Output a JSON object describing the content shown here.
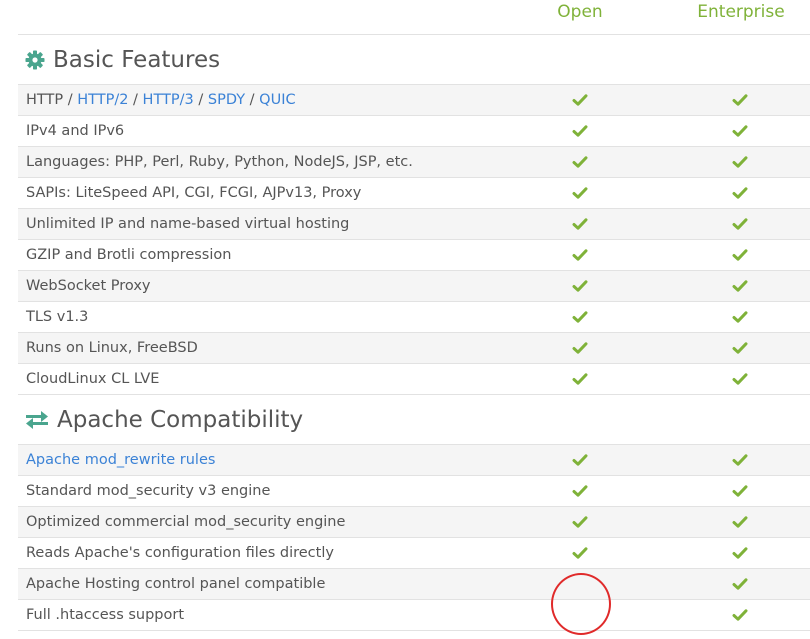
{
  "columns": {
    "open": "Open",
    "enterprise": "Enterprise"
  },
  "colors": {
    "accent": "#7fb239",
    "link": "#3b82d6",
    "icon": "#4aa58e",
    "annotation": "#e02a2a"
  },
  "basic": {
    "title": "Basic Features",
    "icon": "gear-icon",
    "http_row": {
      "p1": "HTTP",
      "sep": " / ",
      "l1": "HTTP/2",
      "l2": "HTTP/3",
      "l3": "SPDY",
      "l4": "QUIC"
    },
    "rows": [
      {
        "label": "IPv4 and IPv6",
        "open": true,
        "enterprise": true
      },
      {
        "label": "Languages: PHP, Perl, Ruby, Python, NodeJS, JSP, etc.",
        "open": true,
        "enterprise": true
      },
      {
        "label": "SAPIs: LiteSpeed API, CGI, FCGI, AJPv13, Proxy",
        "open": true,
        "enterprise": true
      },
      {
        "label": "Unlimited IP and name-based virtual hosting",
        "open": true,
        "enterprise": true
      },
      {
        "label": "GZIP and Brotli compression",
        "open": true,
        "enterprise": true
      },
      {
        "label": "WebSocket Proxy",
        "open": true,
        "enterprise": true
      },
      {
        "label": "TLS v1.3",
        "open": true,
        "enterprise": true
      },
      {
        "label": "Runs on Linux, FreeBSD",
        "open": true,
        "enterprise": true
      },
      {
        "label": "CloudLinux CL LVE",
        "open": true,
        "enterprise": true
      }
    ]
  },
  "apache": {
    "title": "Apache Compatibility",
    "icon": "exchange-arrows-icon",
    "rows": [
      {
        "label": "Apache mod_rewrite rules",
        "link": true,
        "open": true,
        "enterprise": true
      },
      {
        "label": "Standard mod_security v3 engine",
        "open": true,
        "enterprise": true
      },
      {
        "label": "Optimized commercial mod_security engine",
        "open": true,
        "enterprise": true
      },
      {
        "label": "Reads Apache's configuration files directly",
        "open": true,
        "enterprise": true
      },
      {
        "label": "Apache Hosting control panel compatible",
        "open": false,
        "enterprise": true
      },
      {
        "label": "Full .htaccess support",
        "open": false,
        "enterprise": true
      }
    ]
  }
}
